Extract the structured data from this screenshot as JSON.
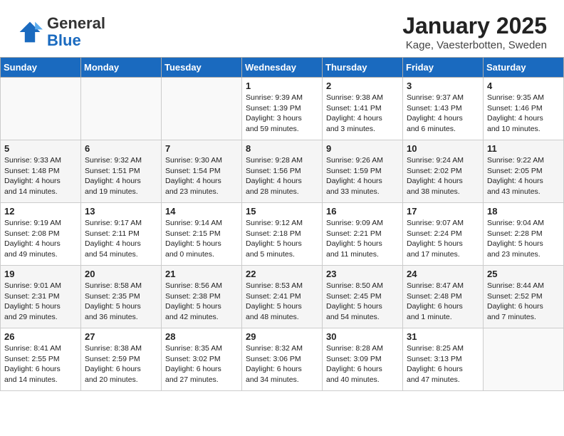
{
  "header": {
    "logo_general": "General",
    "logo_blue": "Blue",
    "month": "January 2025",
    "location": "Kage, Vaesterbotten, Sweden"
  },
  "days_of_week": [
    "Sunday",
    "Monday",
    "Tuesday",
    "Wednesday",
    "Thursday",
    "Friday",
    "Saturday"
  ],
  "weeks": [
    [
      {
        "day": "",
        "info": ""
      },
      {
        "day": "",
        "info": ""
      },
      {
        "day": "",
        "info": ""
      },
      {
        "day": "1",
        "info": "Sunrise: 9:39 AM\nSunset: 1:39 PM\nDaylight: 3 hours\nand 59 minutes."
      },
      {
        "day": "2",
        "info": "Sunrise: 9:38 AM\nSunset: 1:41 PM\nDaylight: 4 hours\nand 3 minutes."
      },
      {
        "day": "3",
        "info": "Sunrise: 9:37 AM\nSunset: 1:43 PM\nDaylight: 4 hours\nand 6 minutes."
      },
      {
        "day": "4",
        "info": "Sunrise: 9:35 AM\nSunset: 1:46 PM\nDaylight: 4 hours\nand 10 minutes."
      }
    ],
    [
      {
        "day": "5",
        "info": "Sunrise: 9:33 AM\nSunset: 1:48 PM\nDaylight: 4 hours\nand 14 minutes."
      },
      {
        "day": "6",
        "info": "Sunrise: 9:32 AM\nSunset: 1:51 PM\nDaylight: 4 hours\nand 19 minutes."
      },
      {
        "day": "7",
        "info": "Sunrise: 9:30 AM\nSunset: 1:54 PM\nDaylight: 4 hours\nand 23 minutes."
      },
      {
        "day": "8",
        "info": "Sunrise: 9:28 AM\nSunset: 1:56 PM\nDaylight: 4 hours\nand 28 minutes."
      },
      {
        "day": "9",
        "info": "Sunrise: 9:26 AM\nSunset: 1:59 PM\nDaylight: 4 hours\nand 33 minutes."
      },
      {
        "day": "10",
        "info": "Sunrise: 9:24 AM\nSunset: 2:02 PM\nDaylight: 4 hours\nand 38 minutes."
      },
      {
        "day": "11",
        "info": "Sunrise: 9:22 AM\nSunset: 2:05 PM\nDaylight: 4 hours\nand 43 minutes."
      }
    ],
    [
      {
        "day": "12",
        "info": "Sunrise: 9:19 AM\nSunset: 2:08 PM\nDaylight: 4 hours\nand 49 minutes."
      },
      {
        "day": "13",
        "info": "Sunrise: 9:17 AM\nSunset: 2:11 PM\nDaylight: 4 hours\nand 54 minutes."
      },
      {
        "day": "14",
        "info": "Sunrise: 9:14 AM\nSunset: 2:15 PM\nDaylight: 5 hours\nand 0 minutes."
      },
      {
        "day": "15",
        "info": "Sunrise: 9:12 AM\nSunset: 2:18 PM\nDaylight: 5 hours\nand 5 minutes."
      },
      {
        "day": "16",
        "info": "Sunrise: 9:09 AM\nSunset: 2:21 PM\nDaylight: 5 hours\nand 11 minutes."
      },
      {
        "day": "17",
        "info": "Sunrise: 9:07 AM\nSunset: 2:24 PM\nDaylight: 5 hours\nand 17 minutes."
      },
      {
        "day": "18",
        "info": "Sunrise: 9:04 AM\nSunset: 2:28 PM\nDaylight: 5 hours\nand 23 minutes."
      }
    ],
    [
      {
        "day": "19",
        "info": "Sunrise: 9:01 AM\nSunset: 2:31 PM\nDaylight: 5 hours\nand 29 minutes."
      },
      {
        "day": "20",
        "info": "Sunrise: 8:58 AM\nSunset: 2:35 PM\nDaylight: 5 hours\nand 36 minutes."
      },
      {
        "day": "21",
        "info": "Sunrise: 8:56 AM\nSunset: 2:38 PM\nDaylight: 5 hours\nand 42 minutes."
      },
      {
        "day": "22",
        "info": "Sunrise: 8:53 AM\nSunset: 2:41 PM\nDaylight: 5 hours\nand 48 minutes."
      },
      {
        "day": "23",
        "info": "Sunrise: 8:50 AM\nSunset: 2:45 PM\nDaylight: 5 hours\nand 54 minutes."
      },
      {
        "day": "24",
        "info": "Sunrise: 8:47 AM\nSunset: 2:48 PM\nDaylight: 6 hours\nand 1 minute."
      },
      {
        "day": "25",
        "info": "Sunrise: 8:44 AM\nSunset: 2:52 PM\nDaylight: 6 hours\nand 7 minutes."
      }
    ],
    [
      {
        "day": "26",
        "info": "Sunrise: 8:41 AM\nSunset: 2:55 PM\nDaylight: 6 hours\nand 14 minutes."
      },
      {
        "day": "27",
        "info": "Sunrise: 8:38 AM\nSunset: 2:59 PM\nDaylight: 6 hours\nand 20 minutes."
      },
      {
        "day": "28",
        "info": "Sunrise: 8:35 AM\nSunset: 3:02 PM\nDaylight: 6 hours\nand 27 minutes."
      },
      {
        "day": "29",
        "info": "Sunrise: 8:32 AM\nSunset: 3:06 PM\nDaylight: 6 hours\nand 34 minutes."
      },
      {
        "day": "30",
        "info": "Sunrise: 8:28 AM\nSunset: 3:09 PM\nDaylight: 6 hours\nand 40 minutes."
      },
      {
        "day": "31",
        "info": "Sunrise: 8:25 AM\nSunset: 3:13 PM\nDaylight: 6 hours\nand 47 minutes."
      },
      {
        "day": "",
        "info": ""
      }
    ]
  ]
}
